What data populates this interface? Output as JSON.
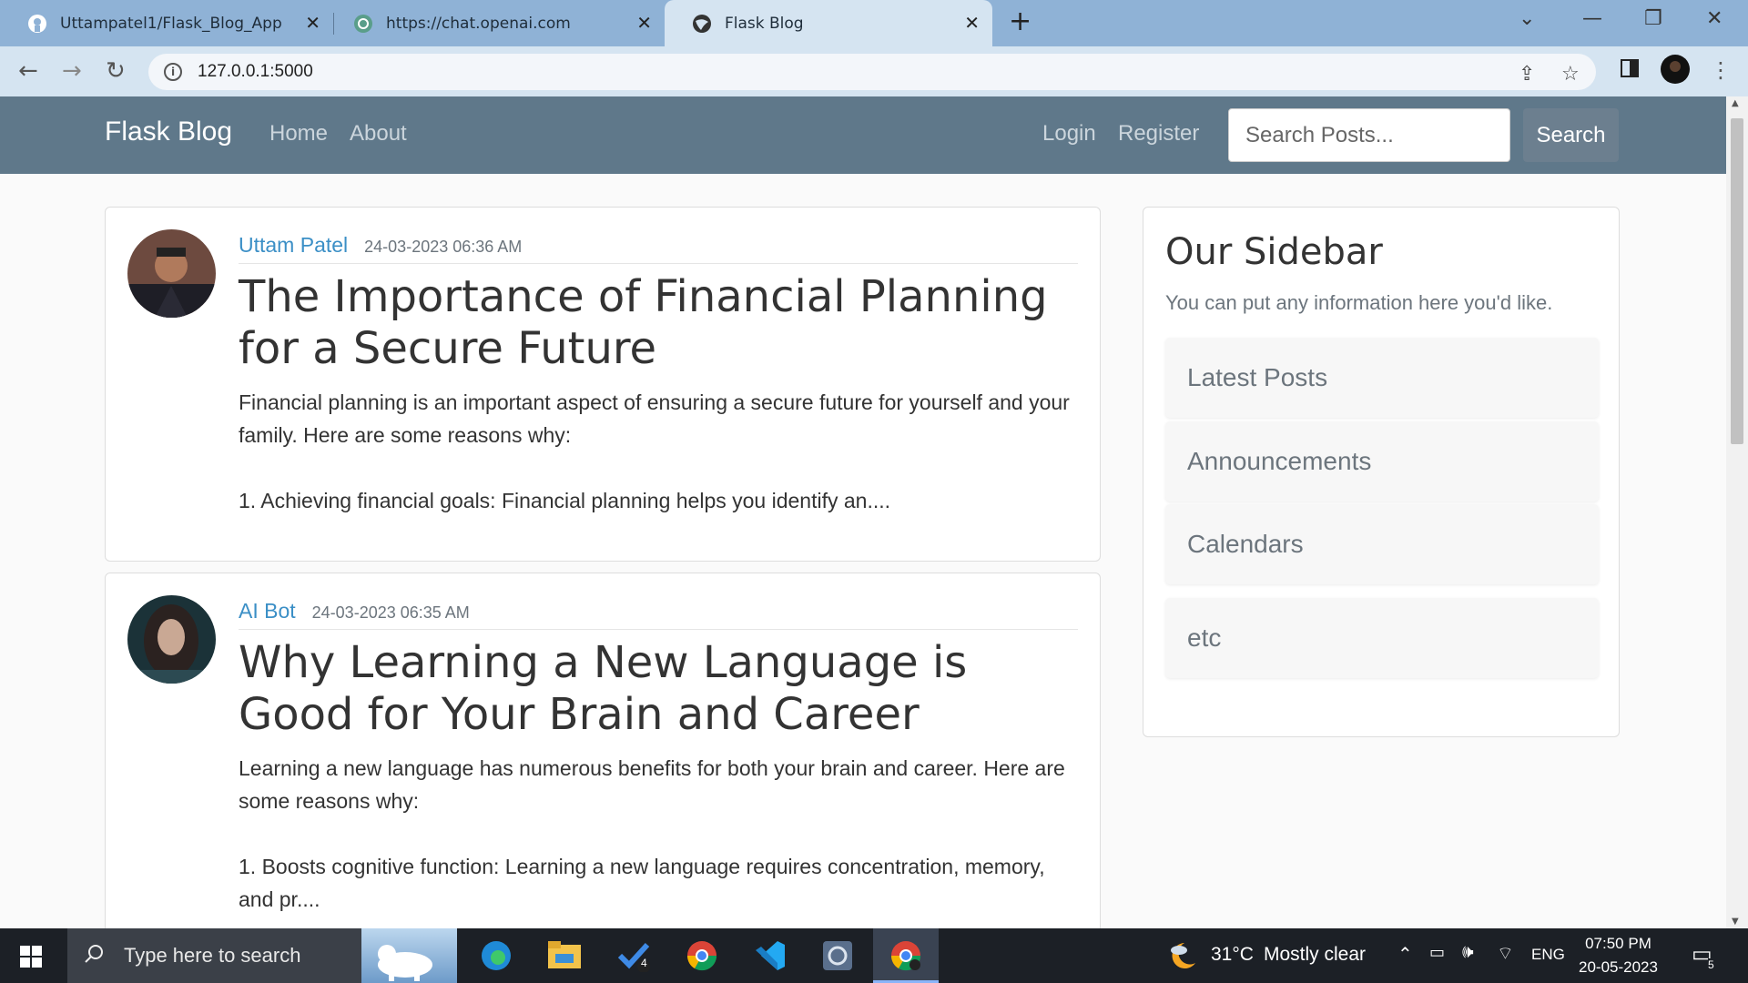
{
  "browser": {
    "tabs": [
      {
        "title": "Uttampatel1/Flask_Blog_App",
        "icon": "github-icon"
      },
      {
        "title": "https://chat.openai.com",
        "icon": "openai-icon"
      },
      {
        "title": "Flask Blog",
        "icon": "globe-icon",
        "active": true
      }
    ],
    "url": "127.0.0.1:5000"
  },
  "site": {
    "brand": "Flask Blog",
    "nav_left": [
      "Home",
      "About"
    ],
    "nav_right": [
      "Login",
      "Register"
    ],
    "search_placeholder": "Search Posts...",
    "search_button": "Search"
  },
  "posts": [
    {
      "author": "Uttam Patel",
      "date": "24-03-2023 06:36 AM",
      "title": "The Importance of Financial Planning for a Secure Future",
      "body": "Financial planning is an important aspect of ensuring a secure future for yourself and your family. Here are some reasons why:\n\n1. Achieving financial goals: Financial planning helps you identify an...."
    },
    {
      "author": "AI Bot",
      "date": "24-03-2023 06:35 AM",
      "title": "Why Learning a New Language is Good for Your Brain and Career",
      "body": "Learning a new language has numerous benefits for both your brain and career. Here are some reasons why:\n\n1. Boosts cognitive function: Learning a new language requires concentration, memory, and pr...."
    }
  ],
  "sidebar": {
    "title": "Our Sidebar",
    "description": "You can put any information here you'd like.",
    "items": [
      "Latest Posts",
      "Announcements",
      "Calendars",
      "etc"
    ]
  },
  "taskbar": {
    "search_placeholder": "Type here to search",
    "todo_badge": "4",
    "weather_temp": "31°C",
    "weather_desc": "Mostly clear",
    "language": "ENG",
    "time": "07:50 PM",
    "date": "20-05-2023",
    "notifications": "5"
  }
}
